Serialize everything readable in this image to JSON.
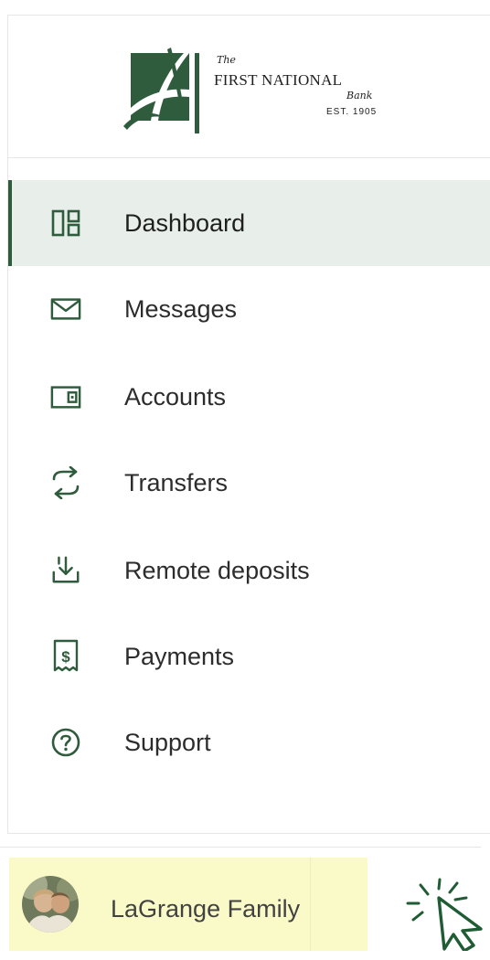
{
  "logo": {
    "the": "The",
    "name": "FIRST NATIONAL",
    "bank": "Bank",
    "established": "EST. 1905",
    "brand_color": "#2f5c3c"
  },
  "nav": {
    "accent_color": "#2f5c3c",
    "active_background": "#e8eeea",
    "items": [
      {
        "label": "Dashboard",
        "icon": "dashboard-icon",
        "active": true
      },
      {
        "label": "Messages",
        "icon": "envelope-icon",
        "active": false
      },
      {
        "label": "Accounts",
        "icon": "wallet-icon",
        "active": false
      },
      {
        "label": "Transfers",
        "icon": "transfer-arrows-icon",
        "active": false
      },
      {
        "label": "Remote deposits",
        "icon": "deposit-icon",
        "active": false
      },
      {
        "label": "Payments",
        "icon": "receipt-icon",
        "active": false
      },
      {
        "label": "Support",
        "icon": "help-circle-icon",
        "active": false
      }
    ]
  },
  "profile": {
    "name": "LaGrange Family",
    "highlight_color": "#fafac8"
  }
}
